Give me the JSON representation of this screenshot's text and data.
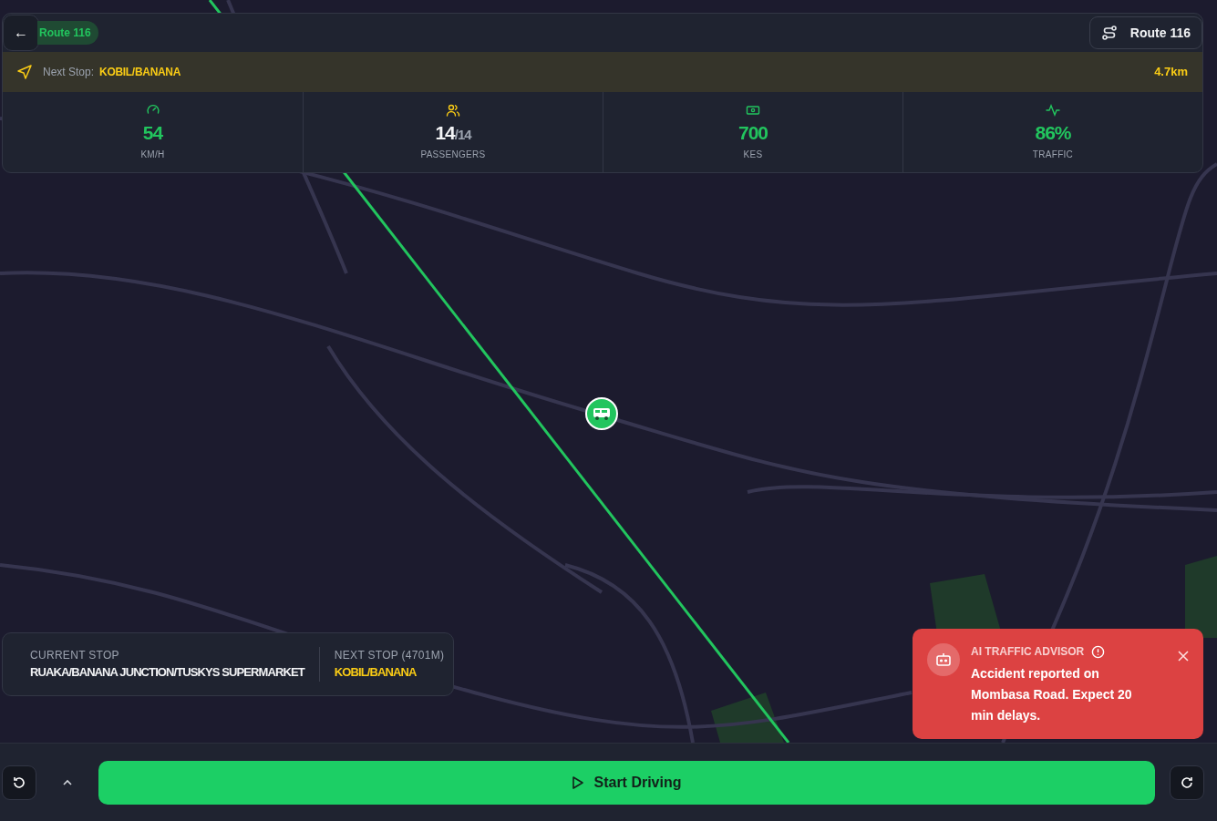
{
  "header": {
    "back_label": "←",
    "route_badge": "Route 116",
    "route_button": "Route 116"
  },
  "next_stop_bar": {
    "label": "Next Stop:",
    "stop": "KOBIL/BANANA",
    "distance": "4.7km"
  },
  "stats": [
    {
      "kind": "speed",
      "value": "54",
      "unit": "KM/H",
      "color": "#22c55e"
    },
    {
      "kind": "passengers",
      "value": "14",
      "total": "/14",
      "unit": "PASSENGERS",
      "color": "#f3f4f6"
    },
    {
      "kind": "money",
      "value": "700",
      "unit": "KES",
      "color": "#22c55e"
    },
    {
      "kind": "traffic",
      "value": "86%",
      "unit": "TRAFFIC",
      "color": "#22c55e"
    }
  ],
  "stop_card": {
    "current_label": "CURRENT STOP",
    "current_stop": "RUAKA/BANANA JUNCTION/TUSKYS SUPERMARKET",
    "next_label": "NEXT STOP (4701M)",
    "next_stop": "KOBIL/BANANA"
  },
  "alert": {
    "title": "AI TRAFFIC ADVISOR",
    "message": "Accident reported on Mombasa Road. Expect 20 min delays."
  },
  "bottom_bar": {
    "start_button": "Start Driving"
  }
}
